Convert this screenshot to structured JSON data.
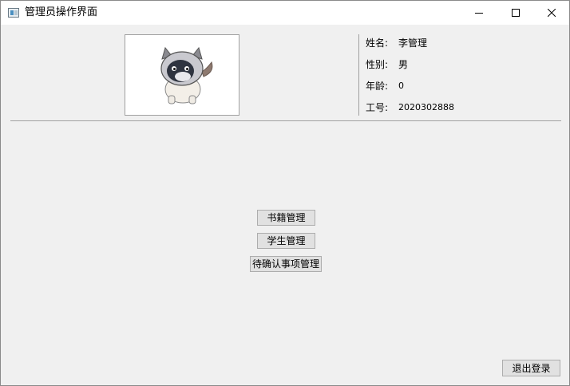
{
  "window": {
    "title": "管理员操作界面",
    "controls": [
      "minimize-icon",
      "maximize-icon",
      "close-icon"
    ]
  },
  "profile": {
    "avatar_icon": "cat-avatar-icon",
    "fields": [
      {
        "label": "姓名:",
        "value": "李管理"
      },
      {
        "label": "性别:",
        "value": "男"
      },
      {
        "label": "年龄:",
        "value": "0"
      },
      {
        "label": "工号:",
        "value": "2020302888"
      }
    ]
  },
  "actions": {
    "books": "书籍管理",
    "students": "学生管理",
    "pending": "待确认事项管理"
  },
  "footer": {
    "logout": "退出登录"
  }
}
